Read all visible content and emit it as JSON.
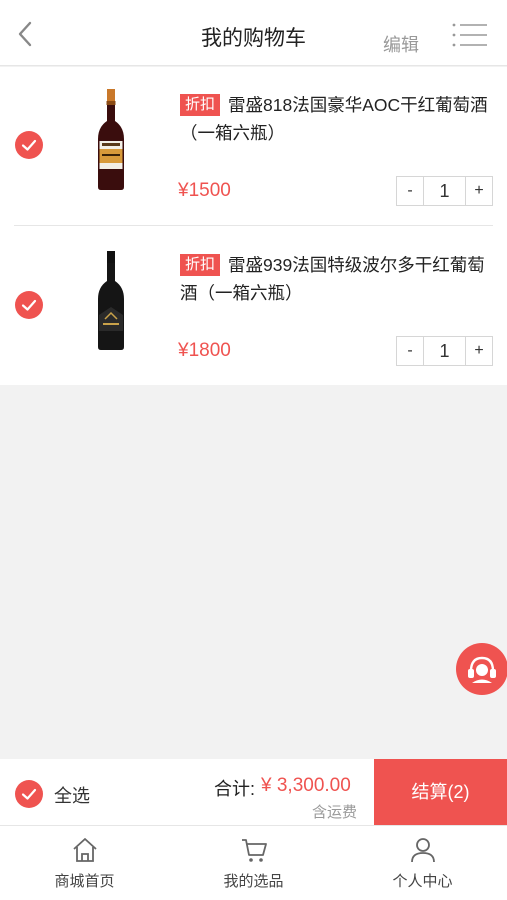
{
  "header": {
    "title": "我的购物车",
    "edit_label": "编辑"
  },
  "cart": {
    "items": [
      {
        "tag": "折扣",
        "title": "雷盛818法国豪华AOC干红葡萄酒（一箱六瓶）",
        "price": "¥1500",
        "quantity": "1",
        "minus": "-",
        "plus": "+",
        "checked": true
      },
      {
        "tag": "折扣",
        "title": "雷盛939法国特级波尔多干红葡萄酒（一箱六瓶）",
        "price": "¥1800",
        "quantity": "1",
        "minus": "-",
        "plus": "+",
        "checked": true
      }
    ]
  },
  "checkout": {
    "select_all_label": "全选",
    "total_label": "合计:",
    "total_amount": "¥ 3,300.00",
    "shipping_note": "含运费",
    "checkout_button": "结算(2)"
  },
  "tabbar": {
    "items": [
      {
        "label": "商城首页",
        "icon": "home-icon"
      },
      {
        "label": "我的选品",
        "icon": "cart-icon"
      },
      {
        "label": "个人中心",
        "icon": "user-icon"
      }
    ]
  },
  "colors": {
    "accent": "#ef5350",
    "background": "#f2f2f2"
  }
}
